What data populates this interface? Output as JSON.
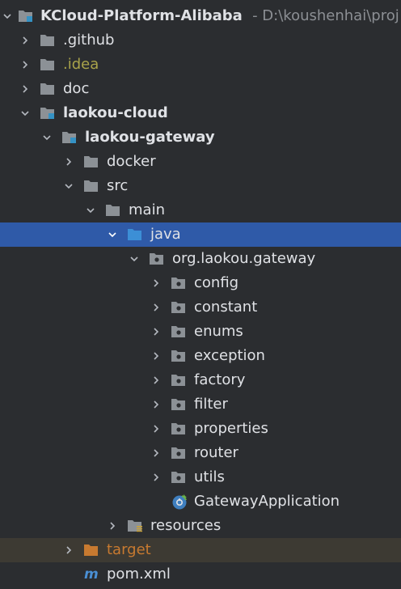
{
  "project_tree": {
    "root": {
      "name": "KCloud-Platform-Alibaba",
      "path": "- D:\\koushenhai\\proj"
    },
    "items": [
      {
        "label": ".github"
      },
      {
        "label": ".idea"
      },
      {
        "label": "doc"
      },
      {
        "label": "laokou-cloud"
      },
      {
        "label": "laokou-gateway"
      },
      {
        "label": "docker"
      },
      {
        "label": "src"
      },
      {
        "label": "main"
      },
      {
        "label": "java"
      },
      {
        "label": "org.laokou.gateway"
      },
      {
        "label": "config"
      },
      {
        "label": "constant"
      },
      {
        "label": "enums"
      },
      {
        "label": "exception"
      },
      {
        "label": "factory"
      },
      {
        "label": "filter"
      },
      {
        "label": "properties"
      },
      {
        "label": "router"
      },
      {
        "label": "utils"
      },
      {
        "label": "GatewayApplication"
      },
      {
        "label": "resources"
      },
      {
        "label": "target"
      },
      {
        "label": "pom.xml"
      }
    ]
  },
  "colors": {
    "background": "#2b2d30",
    "selection": "#2f5aa8",
    "text": "#dfe1e5",
    "excluded_text": "#a9a34a",
    "target_text": "#c87a30",
    "folder": "#8c9196",
    "source_folder": "#3c8fd6",
    "module_badge": "#3592c4"
  }
}
